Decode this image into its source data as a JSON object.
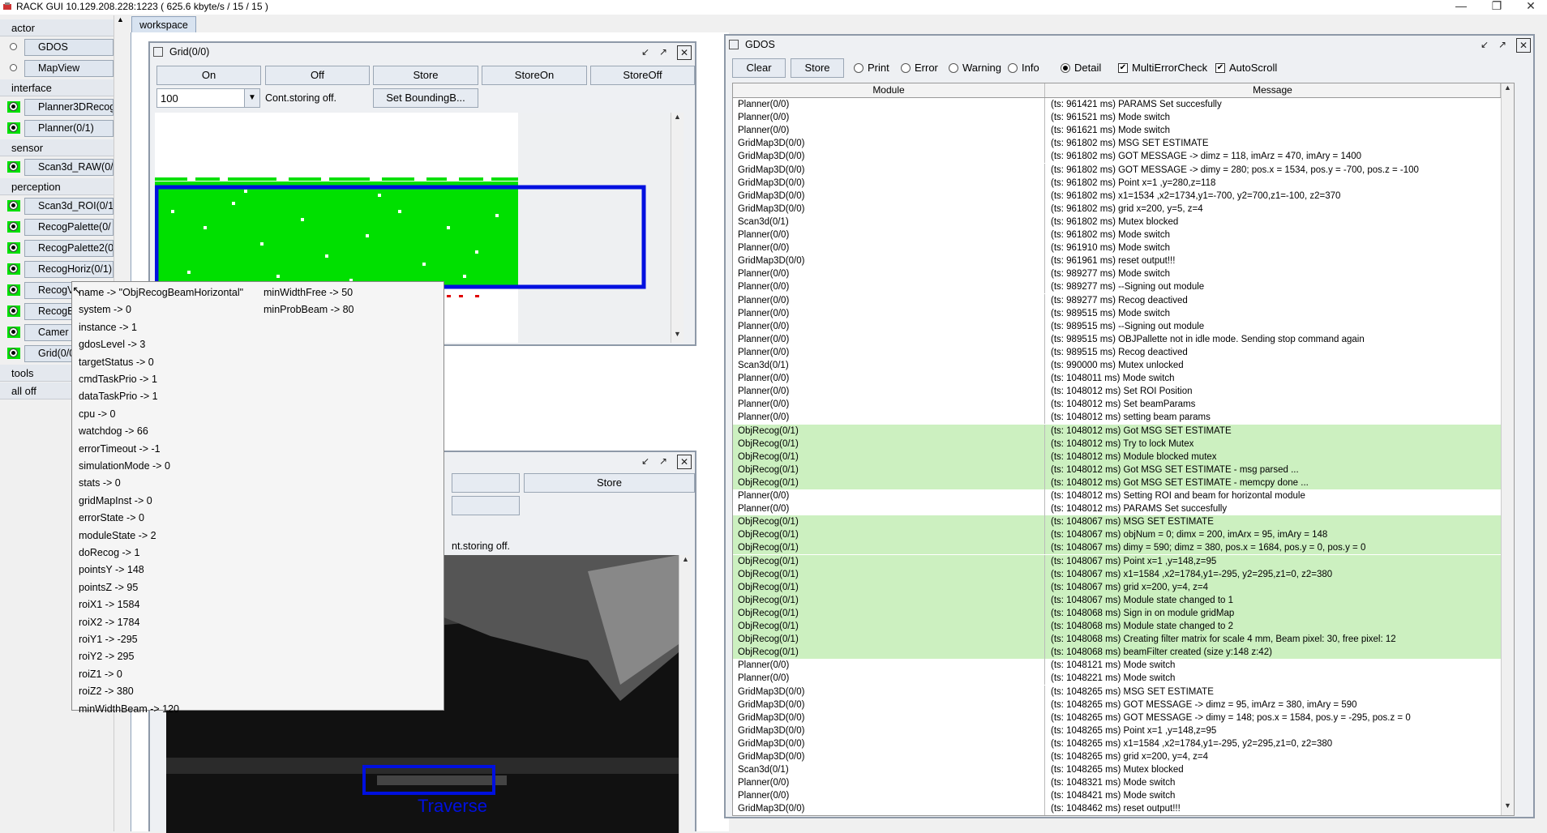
{
  "window": {
    "title": "RACK GUI 10.129.208.228:1223 ( 625.6 kbyte/s / 15 / 15 )"
  },
  "sidebar": {
    "groups": [
      {
        "header": "actor",
        "items": [
          {
            "label": "GDOS",
            "active": false
          },
          {
            "label": "MapView",
            "active": false
          }
        ]
      },
      {
        "header": "interface",
        "items": [
          {
            "label": "Planner3DRecog",
            "active": true
          },
          {
            "label": "Planner(0/1)",
            "active": true
          }
        ]
      },
      {
        "header": "sensor",
        "items": [
          {
            "label": "Scan3d_RAW(0/",
            "active": true
          }
        ]
      },
      {
        "header": "perception",
        "items": [
          {
            "label": "Scan3d_ROI(0/1)",
            "active": true
          },
          {
            "label": "RecogPalette(0/",
            "active": true
          },
          {
            "label": "RecogPalette2(0",
            "active": true
          },
          {
            "label": "RecogHoriz(0/1)",
            "active": true
          },
          {
            "label": "RecogV",
            "active": true
          },
          {
            "label": "RecogB",
            "active": true
          },
          {
            "label": "Camer",
            "active": true
          },
          {
            "label": "Grid(0/0)",
            "active": true
          }
        ]
      },
      {
        "header": "tools",
        "items": []
      },
      {
        "header": "all off",
        "items": []
      }
    ]
  },
  "workspace": {
    "tab": "workspace"
  },
  "grid_frame": {
    "title": "Grid(0/0)",
    "buttons": [
      "On",
      "Off",
      "Store",
      "StoreOn",
      "StoreOff"
    ],
    "combo_value": "100",
    "status": "Cont.storing off.",
    "bbox_button": "Set BoundingB..."
  },
  "camera_frame": {
    "store_button": "Store",
    "status_partial": "nt.storing off.",
    "overlay_label": "Traverse"
  },
  "popup": {
    "col1": [
      "name -> \"ObjRecogBeamHorizontal\"",
      "system -> 0",
      "instance -> 1",
      "gdosLevel -> 3",
      "targetStatus -> 0",
      "cmdTaskPrio -> 1",
      "dataTaskPrio -> 1",
      "cpu -> 0",
      "watchdog -> 66",
      "errorTimeout -> -1",
      "simulationMode -> 0",
      "stats -> 0",
      "gridMapInst -> 0",
      "errorState -> 0",
      "moduleState -> 2",
      "doRecog -> 1",
      "pointsY -> 148",
      "pointsZ -> 95",
      "roiX1 -> 1584",
      "roiX2 -> 1784",
      "roiY1 -> -295",
      "roiY2 -> 295",
      "roiZ1 -> 0",
      "roiZ2 -> 380",
      "minWidthBeam -> 120"
    ],
    "col2": [
      "minWidthFree -> 50",
      "minProbBeam -> 80"
    ]
  },
  "gdos": {
    "title": "GDOS",
    "clear_button": "Clear",
    "store_button": "Store",
    "levels": [
      {
        "label": "Print",
        "selected": false
      },
      {
        "label": "Error",
        "selected": false
      },
      {
        "label": "Warning",
        "selected": false
      },
      {
        "label": "Info",
        "selected": false
      },
      {
        "label": "Detail",
        "selected": true
      }
    ],
    "checks": [
      {
        "label": "MultiErrorCheck",
        "checked": true
      },
      {
        "label": "AutoScroll",
        "checked": true
      }
    ],
    "columns": [
      "Module",
      "Message"
    ],
    "highlight_color": "#ccf0c0",
    "rows": [
      [
        "Planner(0/0)",
        "(ts: 961421 ms) PARAMS Set succesfully",
        false
      ],
      [
        "Planner(0/0)",
        "(ts: 961521 ms) Mode switch",
        false
      ],
      [
        "Planner(0/0)",
        "(ts: 961621 ms) Mode switch",
        false
      ],
      [
        "GridMap3D(0/0)",
        "(ts: 961802 ms) MSG  SET  ESTIMATE",
        false
      ],
      [
        "GridMap3D(0/0)",
        "(ts: 961802 ms) GOT MESSAGE -> dimz = 118, imArz = 470, imAry = 1400",
        false
      ],
      [
        "GridMap3D(0/0)",
        "(ts: 961802 ms) GOT MESSAGE -> dimy = 280; pos.x = 1534, pos.y = -700, pos.z = -100",
        false
      ],
      [
        "GridMap3D(0/0)",
        "(ts: 961802 ms) Point x=1 ,y=280,z=118",
        false
      ],
      [
        "GridMap3D(0/0)",
        "(ts: 961802 ms) x1=1534 ,x2=1734,y1=-700, y2=700,z1=-100, z2=370",
        false
      ],
      [
        "GridMap3D(0/0)",
        "(ts: 961802 ms) grid x=200, y=5, z=4",
        false
      ],
      [
        "Scan3d(0/1)",
        "(ts: 961802 ms) Mutex blocked",
        false
      ],
      [
        "Planner(0/0)",
        "(ts: 961802 ms) Mode switch",
        false
      ],
      [
        "Planner(0/0)",
        "(ts: 961910 ms) Mode switch",
        false
      ],
      [
        "GridMap3D(0/0)",
        "(ts: 961961 ms) reset output!!!",
        false
      ],
      [
        "Planner(0/0)",
        "(ts: 989277 ms) Mode switch",
        false
      ],
      [
        "Planner(0/0)",
        "(ts: 989277 ms) --Signing out module",
        false
      ],
      [
        "Planner(0/0)",
        "(ts: 989277 ms) Recog deactived",
        false
      ],
      [
        "Planner(0/0)",
        "(ts: 989515 ms) Mode switch",
        false
      ],
      [
        "Planner(0/0)",
        "(ts: 989515 ms) --Signing out module",
        false
      ],
      [
        "Planner(0/0)",
        "(ts: 989515 ms) OBJPallette not in idle mode. Sending stop command again",
        false
      ],
      [
        "Planner(0/0)",
        "(ts: 989515 ms) Recog deactived",
        false
      ],
      [
        "Scan3d(0/1)",
        "(ts: 990000 ms) Mutex unlocked",
        false
      ],
      [
        "Planner(0/0)",
        "(ts: 1048011 ms) Mode switch",
        false
      ],
      [
        "Planner(0/0)",
        "(ts: 1048012 ms) Set ROI Position",
        false
      ],
      [
        "Planner(0/0)",
        "(ts: 1048012 ms) Set beamParams",
        false
      ],
      [
        "Planner(0/0)",
        "(ts: 1048012 ms) setting beam params",
        false
      ],
      [
        "ObjRecog(0/1)",
        "(ts: 1048012 ms) Got MSG  SET  ESTIMATE",
        true
      ],
      [
        "ObjRecog(0/1)",
        "(ts: 1048012 ms) Try to lock Mutex",
        true
      ],
      [
        "ObjRecog(0/1)",
        "(ts: 1048012 ms) Module blocked mutex",
        true
      ],
      [
        "ObjRecog(0/1)",
        "(ts: 1048012 ms) Got MSG  SET  ESTIMATE - msg parsed ...",
        true
      ],
      [
        "ObjRecog(0/1)",
        "(ts: 1048012 ms) Got MSG  SET  ESTIMATE - memcpy done ...",
        true
      ],
      [
        "Planner(0/0)",
        "(ts: 1048012 ms) Setting ROI and beam for horizontal module",
        false
      ],
      [
        "Planner(0/0)",
        "(ts: 1048012 ms) PARAMS Set succesfully",
        false
      ],
      [
        "ObjRecog(0/1)",
        "(ts: 1048067 ms) MSG  SET  ESTIMATE",
        true
      ],
      [
        "ObjRecog(0/1)",
        "(ts: 1048067 ms) objNum = 0; dimx = 200, imArx = 95, imAry = 148",
        true
      ],
      [
        "ObjRecog(0/1)",
        "(ts: 1048067 ms) dimy = 590; dimz = 380, pos.x = 1684, pos.y = 0, pos.y = 0",
        true
      ],
      [
        "ObjRecog(0/1)",
        "(ts: 1048067 ms) Point x=1 ,y=148,z=95",
        true
      ],
      [
        "ObjRecog(0/1)",
        "(ts: 1048067 ms) x1=1584 ,x2=1784,y1=-295, y2=295,z1=0, z2=380",
        true
      ],
      [
        "ObjRecog(0/1)",
        "(ts: 1048067 ms) grid x=200, y=4, z=4",
        true
      ],
      [
        "ObjRecog(0/1)",
        "(ts: 1048067 ms) Module state changed to 1",
        true
      ],
      [
        "ObjRecog(0/1)",
        "(ts: 1048068 ms) Sign in on module gridMap",
        true
      ],
      [
        "ObjRecog(0/1)",
        "(ts: 1048068 ms) Module state changed to 2",
        true
      ],
      [
        "ObjRecog(0/1)",
        "(ts: 1048068 ms) Creating filter matrix for scale 4 mm, Beam pixel: 30, free pixel: 12",
        true
      ],
      [
        "ObjRecog(0/1)",
        "(ts: 1048068 ms) beamFilter created (size y:148 z:42)",
        true
      ],
      [
        "Planner(0/0)",
        "(ts: 1048121 ms) Mode switch",
        false
      ],
      [
        "Planner(0/0)",
        "(ts: 1048221 ms) Mode switch",
        false
      ],
      [
        "GridMap3D(0/0)",
        "(ts: 1048265 ms) MSG  SET  ESTIMATE",
        false
      ],
      [
        "GridMap3D(0/0)",
        "(ts: 1048265 ms) GOT MESSAGE -> dimz = 95, imArz = 380, imAry = 590",
        false
      ],
      [
        "GridMap3D(0/0)",
        "(ts: 1048265 ms) GOT MESSAGE -> dimy = 148; pos.x = 1584, pos.y = -295, pos.z = 0",
        false
      ],
      [
        "GridMap3D(0/0)",
        "(ts: 1048265 ms) Point x=1 ,y=148,z=95",
        false
      ],
      [
        "GridMap3D(0/0)",
        "(ts: 1048265 ms) x1=1584 ,x2=1784,y1=-295, y2=295,z1=0, z2=380",
        false
      ],
      [
        "GridMap3D(0/0)",
        "(ts: 1048265 ms) grid x=200, y=4, z=4",
        false
      ],
      [
        "Scan3d(0/1)",
        "(ts: 1048265 ms) Mutex blocked",
        false
      ],
      [
        "Planner(0/0)",
        "(ts: 1048321 ms) Mode switch",
        false
      ],
      [
        "Planner(0/0)",
        "(ts: 1048421 ms) Mode switch",
        false
      ],
      [
        "GridMap3D(0/0)",
        "(ts: 1048462 ms) reset output!!!",
        false
      ]
    ]
  }
}
